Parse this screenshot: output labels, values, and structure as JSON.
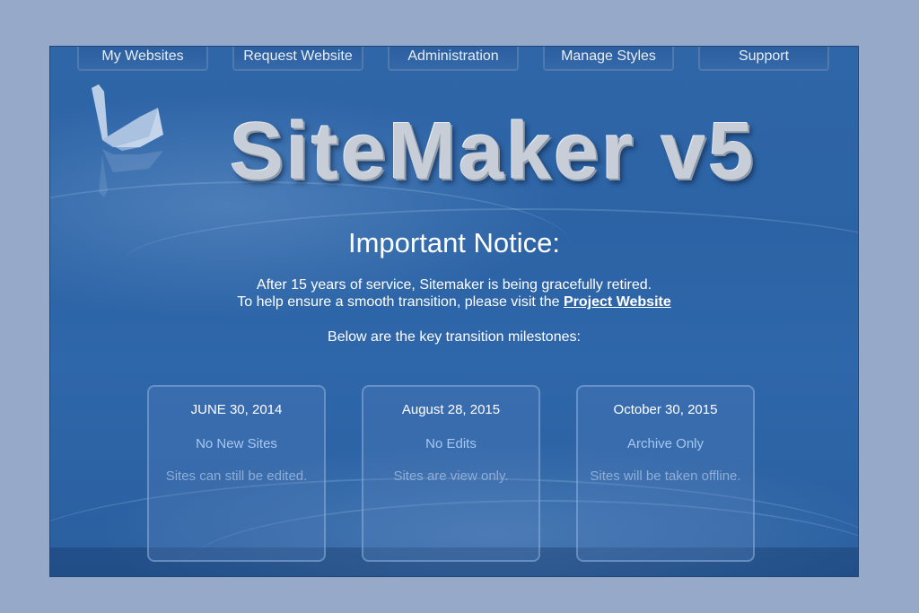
{
  "nav": {
    "items": [
      {
        "label": "My Websites"
      },
      {
        "label": "Request Website"
      },
      {
        "label": "Administration"
      },
      {
        "label": "Manage Styles"
      },
      {
        "label": "Support"
      }
    ]
  },
  "header": {
    "title": "SiteMaker v5",
    "logo_icon": "origami-swan-icon"
  },
  "notice": {
    "heading": "Important Notice:",
    "line1": "After 15 years of service, Sitemaker is being gracefully retired.",
    "line2_prefix": "To help ensure a smooth transition,  please visit the",
    "line2_link": "Project Website",
    "milestones_intro": "Below are the key transition milestones:"
  },
  "milestones": [
    {
      "date": "JUNE 30, 2014",
      "status": "No New Sites",
      "description": "Sites can still be edited."
    },
    {
      "date": "August 28, 2015",
      "status": "No Edits",
      "description": "Sites are view only."
    },
    {
      "date": "October 30, 2015",
      "status": "Archive Only",
      "description": "Sites will be taken offline."
    }
  ],
  "colors": {
    "page_background": "#96a9c9",
    "panel_blue": "#2f66a8",
    "status_text": "#a7c7f2"
  }
}
